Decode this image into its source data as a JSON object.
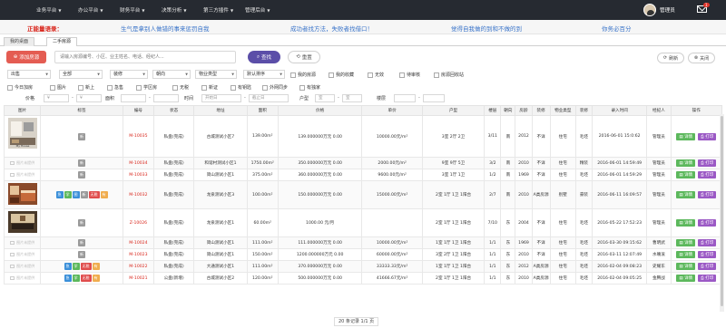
{
  "nav": {
    "menus": [
      "业务平台",
      "办公平台",
      "财务平台",
      "决策分析",
      "第三方插件",
      "管理后台"
    ],
    "user_name": "管理员",
    "mail_count": "1"
  },
  "ticker": {
    "label": "正能量语录：",
    "messages": [
      "生气是拿别人做错的事来惩罚自我",
      "成功者找方法，失败者找借口！",
      "觉得自我做的到和不做的到",
      "你务必百分"
    ]
  },
  "tabs": [
    "我的桌面",
    "二手房源"
  ],
  "toolbar": {
    "add_label": "添加房源",
    "search_placeholder": "请输入房源编号、小区、业主姓名、电话、经纪人...",
    "search_label": "查找",
    "reset_label": "重置",
    "refresh_label": "刷新",
    "close_label": "关闭"
  },
  "filters": {
    "row1": {
      "selects": [
        "出售",
        "全部",
        "装修",
        "朝向",
        "物业类型",
        "默认排序"
      ],
      "checks": [
        "我的房源",
        "我的收藏",
        "无效",
        "待审核",
        "房源回收站"
      ]
    },
    "row2": {
      "checks": [
        "今日加房",
        "图片",
        "新上",
        "急售",
        "学区房",
        "无税",
        "新证",
        "有钥匙",
        "外网同步",
        "有独家"
      ]
    },
    "row3": {
      "price_label": "价格",
      "price_unit": "¥",
      "area_label": "面积",
      "time_label": "时间",
      "time_start": "开始日",
      "time_end": "截止日",
      "layout_label": "户型",
      "room_unit": "室",
      "floor_label": "楼层"
    }
  },
  "table": {
    "headers": [
      "图片",
      "标签",
      "编号",
      "状态",
      "地址",
      "面积",
      "价格",
      "单价",
      "户型",
      "楼层",
      "朝向",
      "房龄",
      "装修",
      "物业类型",
      "装修",
      "录入时间",
      "经纪人",
      "操作"
    ],
    "no_image_label": "图片未提供",
    "detail_label": "详情",
    "print_label": "打印",
    "rows": [
      {
        "img": "room",
        "tags": [
          "新"
        ],
        "code": "M-10035",
        "status": "私盘(完成)",
        "addr": "古城测试小区7",
        "area": "139.00m²",
        "price": "139.000000万元 0.00",
        "unit": "10000.00元/m²",
        "layout": "3室 2厅 2卫",
        "floor": "3/11",
        "dir": "南",
        "age": "2012",
        "deco": "不详",
        "ptype": "住宅",
        "deco2": "毛坯",
        "time": "2016-06-01 15:0:62",
        "agent": "管理员"
      },
      {
        "img": "none",
        "tags": [
          "新"
        ],
        "code": "M-10034",
        "status": "私盘(完成)",
        "addr": "和谐村测试小区1",
        "area": "1750.00m²",
        "price": "350.000000万元 0.00",
        "unit": "2000.00元/m²",
        "layout": "9室 9厅 5卫",
        "floor": "3/2",
        "dir": "南",
        "age": "2010",
        "deco": "不详",
        "ptype": "住宅",
        "deco2": "精装",
        "time": "2016-06-01 14:59:49",
        "agent": "管理员"
      },
      {
        "img": "none",
        "tags": [
          "新"
        ],
        "code": "M-10033",
        "status": "私盘(完成)",
        "addr": "简山测试小区1",
        "area": "375.00m²",
        "price": "360.000000万元 0.00",
        "unit": "9600.00元/m²",
        "layout": "3室 1厅 1卫",
        "floor": "1/2",
        "dir": "南",
        "age": "1969",
        "deco": "不详",
        "ptype": "住宅",
        "deco2": "毛坯",
        "time": "2016-06-01 14:59:29",
        "agent": "管理员"
      },
      {
        "img": "bedroom",
        "tags": [
          "急",
          "学",
          "图",
          "新",
          "无税",
          "有"
        ],
        "code": "M-10032",
        "status": "私盘(完成)",
        "addr": "龙泉测试小区3",
        "area": "100.00m²",
        "price": "150.000000万元 0.00",
        "unit": "15000.00元/m²",
        "layout": "2室 1厅 1卫 1阳台",
        "floor": "2/7",
        "dir": "南",
        "age": "2010",
        "deco": "A类房源",
        "ptype": "别墅",
        "deco2": "豪装",
        "time": "2016-06-11 16:09:57",
        "agent": "管理员"
      },
      {
        "img": "living",
        "tags": [
          "新"
        ],
        "code": "Z-10026",
        "status": "私盘(完成)",
        "addr": "龙泉测试小区1",
        "area": "60.00m²",
        "price": "1000.00 元/月",
        "unit": "",
        "layout": "2室 1厅 1卫 1阳台",
        "floor": "7/10",
        "dir": "东",
        "age": "2004",
        "deco": "不详",
        "ptype": "住宅",
        "deco2": "毛坯",
        "time": "2016-05-22 17:52:23",
        "agent": "管理员"
      },
      {
        "img": "none",
        "tags": [
          "新"
        ],
        "code": "M-10024",
        "status": "私盘(完成)",
        "addr": "简山测试小区1",
        "area": "111.00m²",
        "price": "111.000000万元 0.00",
        "unit": "10000.00元/m²",
        "layout": "1室 1厅 1卫 1阳台",
        "floor": "1/1",
        "dir": "东",
        "age": "1969",
        "deco": "不详",
        "ptype": "住宅",
        "deco2": "毛坯",
        "time": "2016-03-30 09:15:62",
        "agent": "曹明武"
      },
      {
        "img": "none",
        "tags": [
          "新"
        ],
        "code": "M-10023",
        "status": "私盘(完成)",
        "addr": "简山测试小区1",
        "area": "150.00m²",
        "price": "1200.000000万元 0.00",
        "unit": "60000.00元/m²",
        "layout": "3室 2厅 1卫 1阳台",
        "floor": "1/1",
        "dir": "东",
        "age": "2010",
        "deco": "不详",
        "ptype": "住宅",
        "deco2": "毛坯",
        "time": "2016-03-11 12:07:49",
        "agent": "水嘴滚"
      },
      {
        "img": "none",
        "tags": [
          "急",
          "学",
          "无税",
          "有"
        ],
        "code": "M-10022",
        "status": "私盘(完成)",
        "addr": "大通测试小区1",
        "area": "111.00m²",
        "price": "370.000000万元 0.00",
        "unit": "33333.33元/m²",
        "layout": "1室 1厅 1卫 1阳台",
        "floor": "1/1",
        "dir": "东",
        "age": "2012",
        "deco": "A类房源",
        "ptype": "住宅",
        "deco2": "毛坯",
        "time": "2016-02-04 09:08:23",
        "agent": "史耀东"
      },
      {
        "img": "none",
        "tags": [
          "急",
          "学",
          "无税",
          "有"
        ],
        "code": "M-10021",
        "status": "公盘(新增)",
        "addr": "古城测试小区2",
        "area": "120.00m²",
        "price": "500.000000万元 0.00",
        "unit": "41666.67元/m²",
        "layout": "2室 1厅 1卫 1阳台",
        "floor": "1/1",
        "dir": "东",
        "age": "2010",
        "deco": "A类房源",
        "ptype": "住宅",
        "deco2": "毛坯",
        "time": "2016-02-04 09:05:25",
        "agent": "金腾战"
      }
    ]
  },
  "pager": "20 条记录 1/1 页",
  "colors": {
    "nav_bg": "#262a31",
    "accent_red": "#e45c52",
    "search_purple": "#5b4ea8",
    "detail_green": "#5cb85c",
    "print_purple": "#9b59c5",
    "tag_orange": "#f0ad4e",
    "tag_green": "#5cb85c",
    "tag_blue": "#3a8fd9",
    "tag_red": "#e04c4c",
    "tag_gray": "#9a9a9a"
  }
}
